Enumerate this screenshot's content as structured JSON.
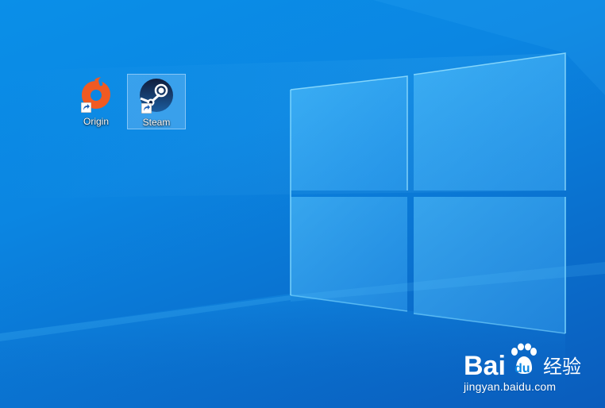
{
  "desktop": {
    "icons": [
      {
        "label": "Origin",
        "icon": "origin-icon",
        "selected": false
      },
      {
        "label": "Steam",
        "icon": "steam-icon",
        "selected": true
      }
    ]
  },
  "watermark": {
    "brand": "Bai",
    "brand_suffix": "经验",
    "url": "jingyan.baidu.com"
  },
  "colors": {
    "background": "#0a86e2",
    "origin_orange": "#f05a22",
    "steam_navy": "#16254a"
  }
}
